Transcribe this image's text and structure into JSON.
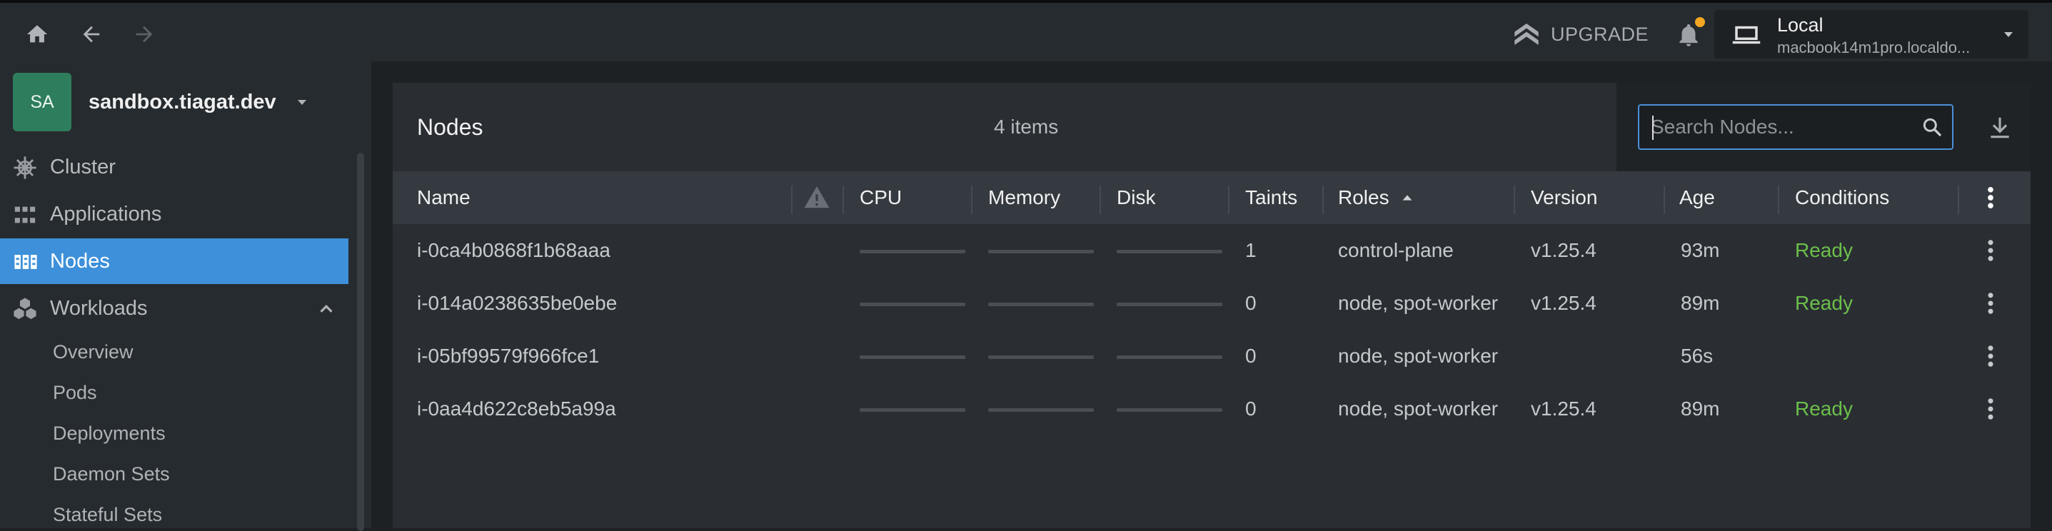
{
  "topbar": {
    "upgrade_label": "UPGRADE",
    "context": {
      "name": "Local",
      "host": "macbook14m1pro.localdo..."
    }
  },
  "sidebar": {
    "avatar": "SA",
    "cluster_name": "sandbox.tiagat.dev",
    "items": [
      {
        "label": "Cluster",
        "icon": "helm-icon"
      },
      {
        "label": "Applications",
        "icon": "grid-icon"
      },
      {
        "label": "Nodes",
        "icon": "nodes-icon",
        "active": true
      },
      {
        "label": "Workloads",
        "icon": "cubes-icon",
        "expanded": true
      }
    ],
    "workloads_sub": [
      "Overview",
      "Pods",
      "Deployments",
      "Daemon Sets",
      "Stateful Sets"
    ]
  },
  "panel": {
    "title": "Nodes",
    "count": "4 items",
    "search_placeholder": "Search Nodes..."
  },
  "table": {
    "columns": [
      "Name",
      "CPU",
      "Memory",
      "Disk",
      "Taints",
      "Roles",
      "Version",
      "Age",
      "Conditions"
    ],
    "rows": [
      {
        "name": "i-0ca4b0868f1b68aaa",
        "taints": "1",
        "roles": "control-plane",
        "version": "v1.25.4",
        "age": "93m",
        "conditions": "Ready"
      },
      {
        "name": "i-014a0238635be0ebe",
        "taints": "0",
        "roles": "node, spot-worker",
        "version": "v1.25.4",
        "age": "89m",
        "conditions": "Ready"
      },
      {
        "name": "i-05bf99579f966fce1",
        "taints": "0",
        "roles": "node, spot-worker",
        "version": "",
        "age": "56s",
        "conditions": ""
      },
      {
        "name": "i-0aa4d622c8eb5a99a",
        "taints": "0",
        "roles": "node, spot-worker",
        "version": "v1.25.4",
        "age": "89m",
        "conditions": "Ready"
      }
    ]
  },
  "colors": {
    "accent": "#3d90d9",
    "ready": "#6cbf4a",
    "notification": "#f5a623",
    "avatar": "#2e7d5c"
  }
}
